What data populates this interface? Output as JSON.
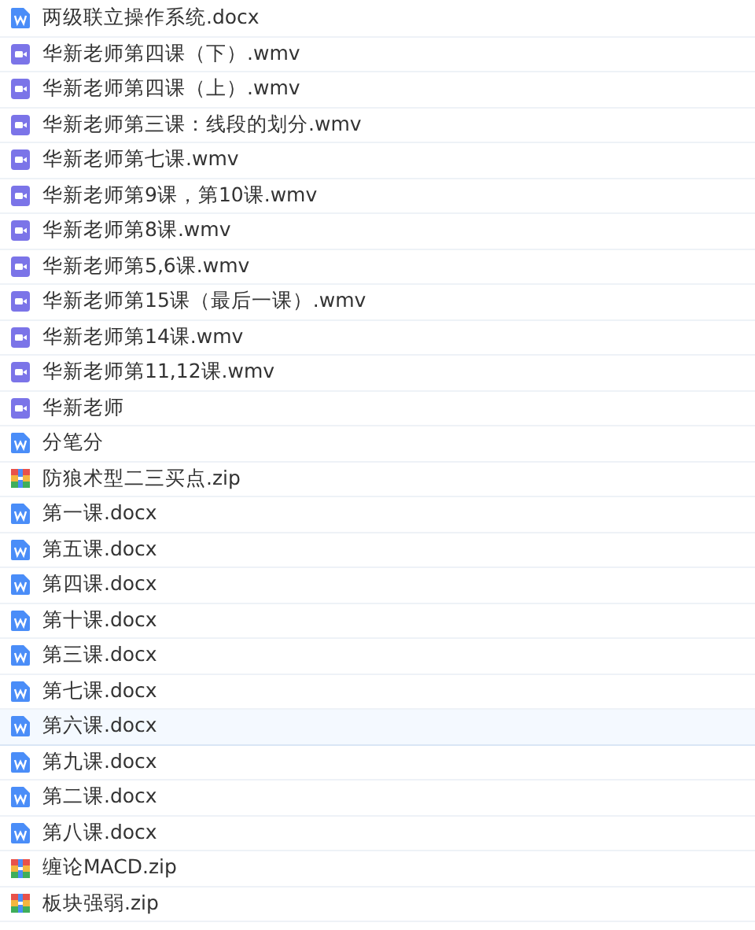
{
  "files": [
    {
      "name": "两级联立操作系统.docx",
      "kind": "docx",
      "selected": false
    },
    {
      "name": "华新老师第四课（下）.wmv",
      "kind": "video",
      "selected": false
    },
    {
      "name": "华新老师第四课（上）.wmv",
      "kind": "video",
      "selected": false
    },
    {
      "name": "华新老师第三课：线段的划分.wmv",
      "kind": "video",
      "selected": false
    },
    {
      "name": "华新老师第七课.wmv",
      "kind": "video",
      "selected": false
    },
    {
      "name": "华新老师第9课，第10课.wmv",
      "kind": "video",
      "selected": false
    },
    {
      "name": "华新老师第8课.wmv",
      "kind": "video",
      "selected": false
    },
    {
      "name": "华新老师第5,6课.wmv",
      "kind": "video",
      "selected": false
    },
    {
      "name": "华新老师第15课（最后一课）.wmv",
      "kind": "video",
      "selected": false
    },
    {
      "name": "华新老师第14课.wmv",
      "kind": "video",
      "selected": false
    },
    {
      "name": "华新老师第11,12课.wmv",
      "kind": "video",
      "selected": false
    },
    {
      "name": "华新老师",
      "kind": "video",
      "selected": false
    },
    {
      "name": "分笔分",
      "kind": "docx",
      "selected": false
    },
    {
      "name": "防狼术型二三买点.zip",
      "kind": "zip",
      "selected": false
    },
    {
      "name": "第一课.docx",
      "kind": "docx",
      "selected": false
    },
    {
      "name": "第五课.docx",
      "kind": "docx",
      "selected": false
    },
    {
      "name": "第四课.docx",
      "kind": "docx",
      "selected": false
    },
    {
      "name": "第十课.docx",
      "kind": "docx",
      "selected": false
    },
    {
      "name": "第三课.docx",
      "kind": "docx",
      "selected": false
    },
    {
      "name": "第七课.docx",
      "kind": "docx",
      "selected": false
    },
    {
      "name": "第六课.docx",
      "kind": "docx",
      "selected": true
    },
    {
      "name": "第九课.docx",
      "kind": "docx",
      "selected": false
    },
    {
      "name": "第二课.docx",
      "kind": "docx",
      "selected": false
    },
    {
      "name": "第八课.docx",
      "kind": "docx",
      "selected": false
    },
    {
      "name": "缠论MACD.zip",
      "kind": "zip",
      "selected": false
    },
    {
      "name": "板块强弱.zip",
      "kind": "zip",
      "selected": false
    }
  ]
}
